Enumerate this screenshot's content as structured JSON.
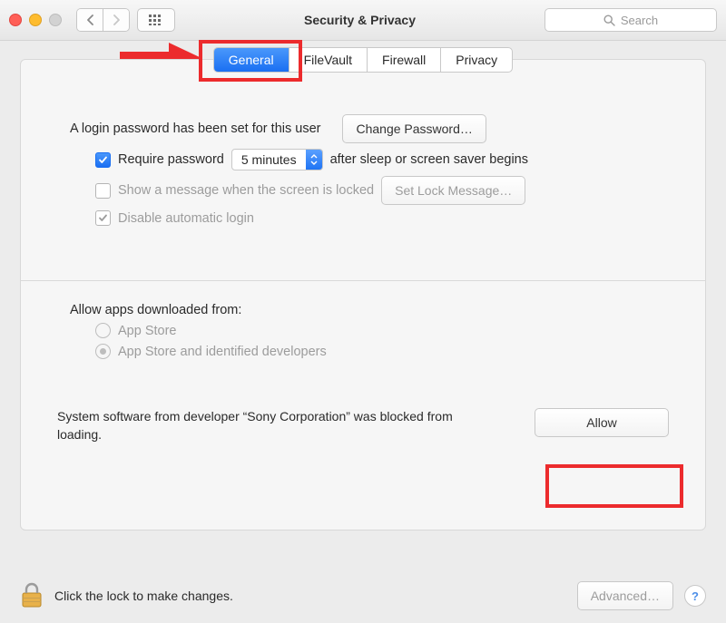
{
  "window": {
    "title": "Security & Privacy",
    "search_placeholder": "Search"
  },
  "tabs": {
    "general": "General",
    "filevault": "FileVault",
    "firewall": "Firewall",
    "privacy": "Privacy",
    "active": "general"
  },
  "general": {
    "login_pw_set": "A login password has been set for this user",
    "change_password_btn": "Change Password…",
    "require_password_label": "Require password",
    "require_password_delay": "5 minutes",
    "require_password_suffix": "after sleep or screen saver begins",
    "show_message_label": "Show a message when the screen is locked",
    "set_lock_message_btn": "Set Lock Message…",
    "disable_auto_login_label": "Disable automatic login",
    "allow_apps_heading": "Allow apps downloaded from:",
    "allow_apps_options": {
      "app_store": "App Store",
      "app_store_identified": "App Store and identified developers"
    },
    "blocked_message": "System software from developer “Sony Corporation” was blocked from loading.",
    "allow_btn": "Allow"
  },
  "footer": {
    "lock_msg": "Click the lock to make changes.",
    "advanced_btn": "Advanced…",
    "help": "?"
  }
}
